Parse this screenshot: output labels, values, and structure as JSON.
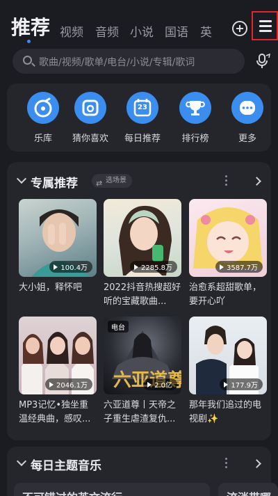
{
  "top_nav": {
    "tabs": [
      {
        "label": "推荐"
      },
      {
        "label": "视频"
      },
      {
        "label": "音频"
      },
      {
        "label": "小说"
      },
      {
        "label": "国语"
      },
      {
        "label": "英"
      }
    ],
    "icons": {
      "add": "add-circle-icon",
      "menu": "menu-icon"
    },
    "highlight_color": "#e3262c",
    "accent_color": "#3d8bf2"
  },
  "search": {
    "placeholder": "歌曲/视频/歌单/电台/小说/专辑/歌词",
    "voice_icon": "voice-search-icon"
  },
  "quick_menu": [
    {
      "label": "乐库",
      "icon": "music-library-icon"
    },
    {
      "label": "猜你喜欢",
      "icon": "guess-like-icon"
    },
    {
      "label": "每日推荐",
      "icon": "calendar-icon",
      "badge": "23"
    },
    {
      "label": "排行榜",
      "icon": "trophy-icon"
    },
    {
      "label": "更多",
      "icon": "more-icon"
    }
  ],
  "section_exclusive": {
    "title": "专属推荐",
    "scene_button": "选场景",
    "cards": [
      {
        "title": "大小姐，释怀吧",
        "plays": "100.4万"
      },
      {
        "title": "2022抖音热搜超好听的宝藏歌曲...",
        "plays": "2285.8万"
      },
      {
        "title": "治愈系超甜歌单，要开心吖",
        "plays": "3587.7万"
      },
      {
        "title": "MP3记忆•独坐重温经典曲，感叹...",
        "plays": "2046.1万"
      },
      {
        "title": "六亚道尊丨天帝之子重生虐渣复仇...",
        "plays": "2.0亿",
        "tag": "电台"
      },
      {
        "title": "那年我们追过的电视剧✨",
        "plays": "177.9万"
      }
    ]
  },
  "section_daily": {
    "title": "每日主题音乐",
    "peek_cards": [
      "不可错过的英文流行",
      "流淌带哪"
    ]
  }
}
